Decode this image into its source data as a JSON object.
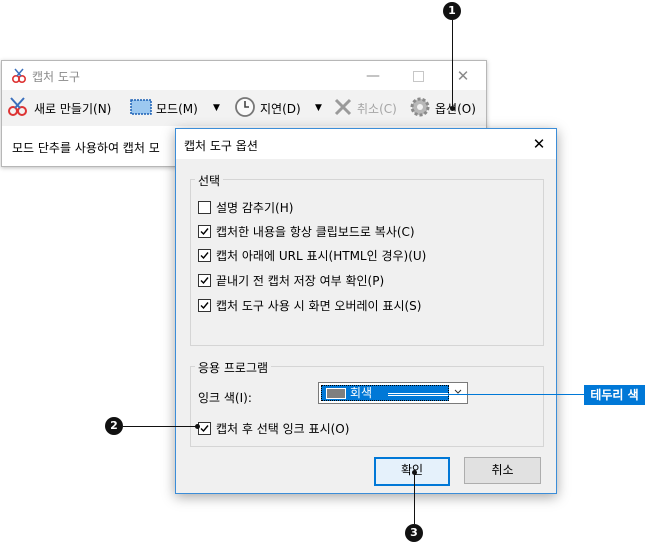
{
  "snip_window": {
    "title": "캡처 도구",
    "toolbar": {
      "new_label": "새로 만들기(N)",
      "mode_label": "모드(M)",
      "delay_label": "지연(D)",
      "cancel_label": "취소(C)",
      "options_label": "옵션(O)"
    },
    "status_text": "모드 단추를 사용하여 캡처 모"
  },
  "dialog": {
    "title": "캡처 도구 옵션",
    "select_group": {
      "label": "선택",
      "options": [
        {
          "label": "설명 감추기(H)",
          "checked": false
        },
        {
          "label": "캡처한 내용을 항상 클립보드로 복사(C)",
          "checked": true
        },
        {
          "label": "캡처 아래에 URL 표시(HTML인 경우)(U)",
          "checked": true
        },
        {
          "label": "끝내기 전 캡처 저장 여부 확인(P)",
          "checked": true
        },
        {
          "label": "캡처 도구 사용 시 화면 오버레이 표시(S)",
          "checked": true
        }
      ]
    },
    "app_group": {
      "label": "응용 프로그램",
      "ink_color_label": "잉크 색(I):",
      "ink_color_value": "회색",
      "ink_color_swatch": "#7f7f7f",
      "show_ink_label": "캡처 후 선택 잉크 표시(O)",
      "show_ink_checked": true
    },
    "ok_label": "확인",
    "cancel_label": "취소"
  },
  "callouts": {
    "marker_1": "1",
    "marker_2": "2",
    "marker_3": "3",
    "border_color_label": "테두리 색"
  },
  "colors": {
    "accent": "#0078d7",
    "dialog_bg": "#f0f0f0",
    "toolbar_bg": "#f2f2f2"
  }
}
